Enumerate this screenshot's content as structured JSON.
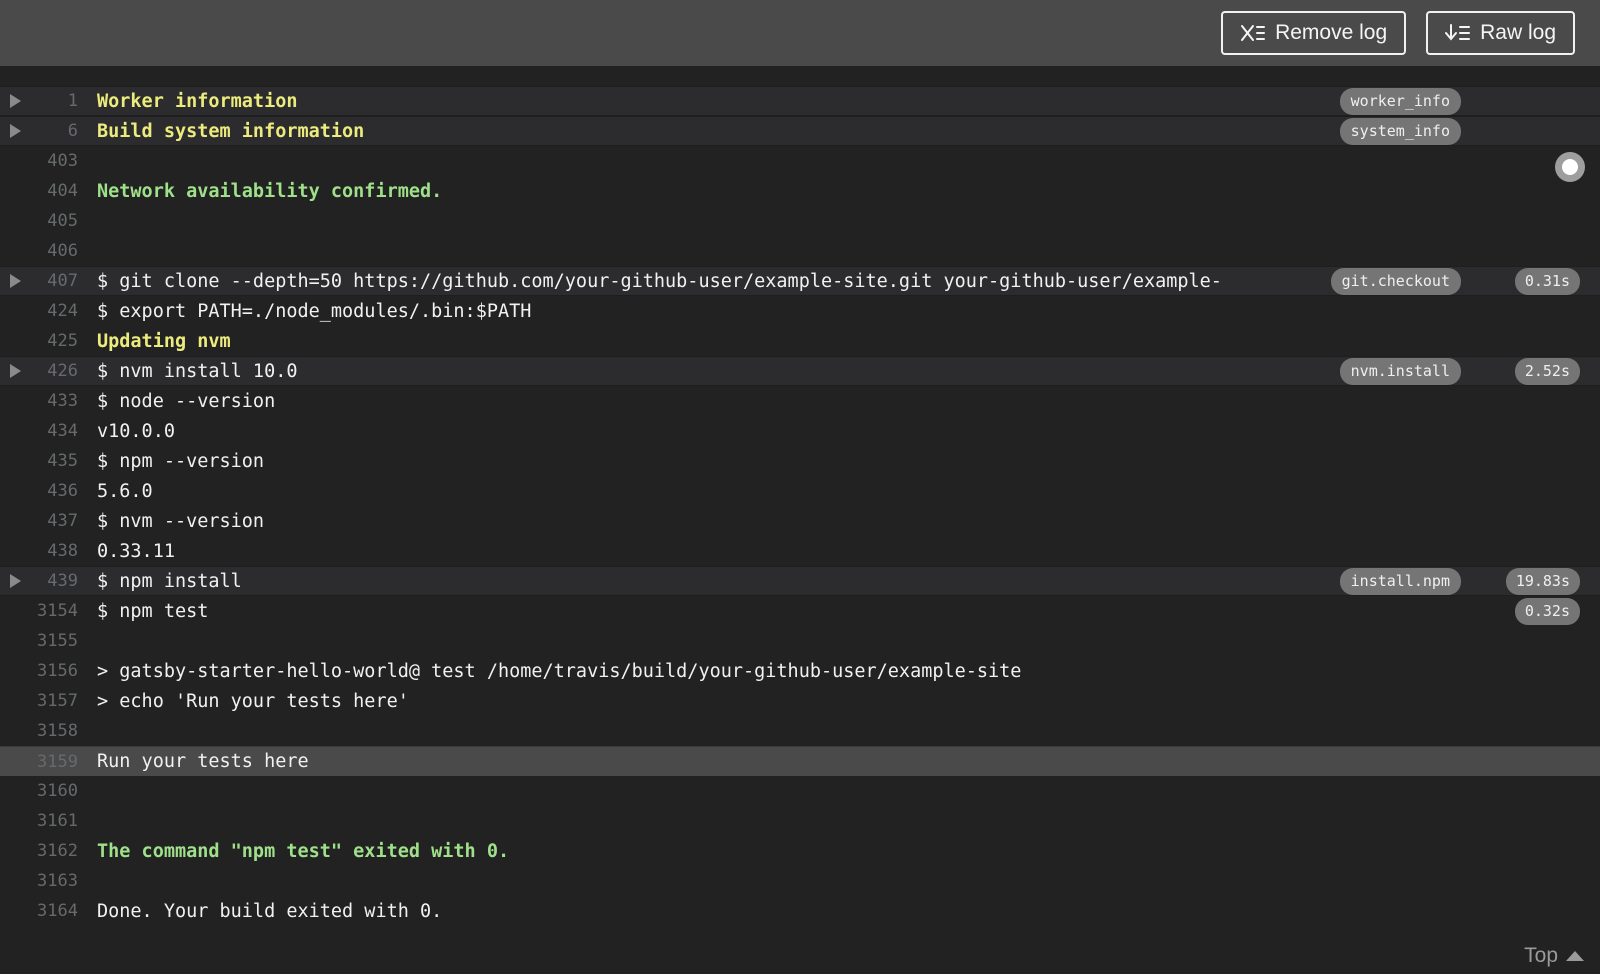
{
  "header": {
    "remove_log_label": "Remove log",
    "remove_log_icon": "x-list-icon",
    "raw_log_label": "Raw log",
    "raw_log_icon": "download-list-icon"
  },
  "log": {
    "rows": [
      {
        "num": "1",
        "text": "Worker information",
        "color": "yellow",
        "fold": true,
        "tag": "worker_info"
      },
      {
        "num": "6",
        "text": "Build system information",
        "color": "yellow",
        "fold": true,
        "tag": "system_info"
      },
      {
        "num": "403",
        "text": ""
      },
      {
        "num": "404",
        "text": "Network availability confirmed.",
        "color": "green"
      },
      {
        "num": "405",
        "text": ""
      },
      {
        "num": "406",
        "text": ""
      },
      {
        "num": "407",
        "text": "$ git clone --depth=50 https://github.com/your-github-user/example-site.git your-github-user/example-",
        "fold": true,
        "tag": "git.checkout",
        "duration": "0.31s"
      },
      {
        "num": "424",
        "text": "$ export PATH=./node_modules/.bin:$PATH"
      },
      {
        "num": "425",
        "text": "Updating nvm",
        "color": "yellow"
      },
      {
        "num": "426",
        "text": "$ nvm install 10.0",
        "fold": true,
        "tag": "nvm.install",
        "duration": "2.52s"
      },
      {
        "num": "433",
        "text": "$ node --version"
      },
      {
        "num": "434",
        "text": "v10.0.0"
      },
      {
        "num": "435",
        "text": "$ npm --version"
      },
      {
        "num": "436",
        "text": "5.6.0"
      },
      {
        "num": "437",
        "text": "$ nvm --version"
      },
      {
        "num": "438",
        "text": "0.33.11"
      },
      {
        "num": "439",
        "text": "$ npm install",
        "fold": true,
        "tag": "install.npm",
        "duration": "19.83s"
      },
      {
        "num": "3154",
        "text": "$ npm test",
        "duration": "0.32s"
      },
      {
        "num": "3155",
        "text": ""
      },
      {
        "num": "3156",
        "text": "> gatsby-starter-hello-world@ test /home/travis/build/your-github-user/example-site"
      },
      {
        "num": "3157",
        "text": "> echo 'Run your tests here'"
      },
      {
        "num": "3158",
        "text": ""
      },
      {
        "num": "3159",
        "text": "Run your tests here",
        "highlighted": true
      },
      {
        "num": "3160",
        "text": ""
      },
      {
        "num": "3161",
        "text": ""
      },
      {
        "num": "3162",
        "text": "The command \"npm test\" exited with 0.",
        "color": "green"
      },
      {
        "num": "3163",
        "text": ""
      },
      {
        "num": "3164",
        "text": "Done. Your build exited with 0."
      }
    ],
    "scroll_indicator_icon": "scroll-position-dot-icon"
  },
  "footer": {
    "top_label": "Top",
    "top_icon": "up-triangle-icon"
  },
  "colors": {
    "header_bg": "#4a4a4a",
    "log_bg": "#222222",
    "fold_row_bg": "#2c2c2e",
    "highlight_row_bg": "#4a4a4a",
    "yellow": "#eceb7d",
    "green": "#9fe08a",
    "badge_bg": "#757575",
    "text": "#f1f1f1",
    "num": "#666a6c"
  }
}
